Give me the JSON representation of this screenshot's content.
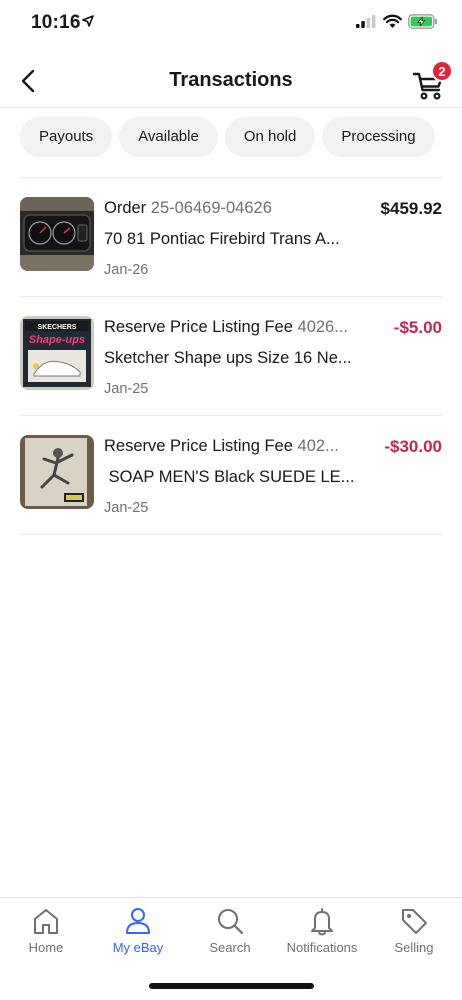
{
  "status_bar": {
    "time": "10:16",
    "icons": [
      "location-arrow-icon",
      "cellular-signal-icon",
      "wifi-icon",
      "battery-charging-icon"
    ],
    "battery_color": "#34c759"
  },
  "header": {
    "title": "Transactions",
    "back_icon": "back-chevron-icon",
    "cart_icon": "cart-icon",
    "cart_count": "2"
  },
  "filters": [
    {
      "label": "Payouts"
    },
    {
      "label": "Available"
    },
    {
      "label": "On hold"
    },
    {
      "label": "Processing"
    }
  ],
  "transactions": [
    {
      "title": "Order",
      "reference": "25-06469-04626",
      "amount": "$459.92",
      "amount_type": "credit",
      "item": "70 81 Pontiac Firebird Trans A...",
      "date": "Jan-26"
    },
    {
      "title": "Reserve Price Listing Fee",
      "reference": "4026...",
      "amount": "-$5.00",
      "amount_type": "debit",
      "item": "Sketcher Shape ups Size 16 Ne...",
      "date": "Jan-25"
    },
    {
      "title": "Reserve Price Listing Fee",
      "reference": "402...",
      "amount": "-$30.00",
      "amount_type": "debit",
      "item": " SOAP MEN'S Black SUEDE LE...",
      "date": "Jan-25"
    }
  ],
  "bottom_nav": [
    {
      "label": "Home",
      "icon": "home-icon",
      "active": false
    },
    {
      "label": "My eBay",
      "icon": "person-icon",
      "active": true
    },
    {
      "label": "Search",
      "icon": "search-icon",
      "active": false
    },
    {
      "label": "Notifications",
      "icon": "bell-icon",
      "active": false
    },
    {
      "label": "Selling",
      "icon": "tag-icon",
      "active": false
    }
  ],
  "colors": {
    "accent": "#3665f3",
    "debit": "#c7254e",
    "badge": "#e0243f"
  }
}
